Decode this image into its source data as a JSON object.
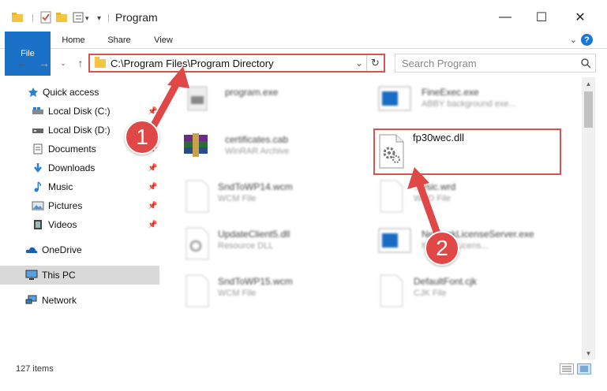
{
  "window": {
    "title": "Program",
    "minimize": "—",
    "maximize": "☐",
    "close": "✕"
  },
  "ribbon": {
    "tabs": [
      "File",
      "Home",
      "Share",
      "View"
    ],
    "help": "?"
  },
  "address": {
    "path": "C:\\Program Files\\Program Directory"
  },
  "search": {
    "placeholder": "Search Program"
  },
  "sidebar": {
    "items": [
      {
        "label": "Quick access",
        "icon": "star-icon"
      },
      {
        "label": "Local Disk (C:)",
        "icon": "drive-icon"
      },
      {
        "label": "Local Disk (D:)",
        "icon": "drive-icon"
      },
      {
        "label": "Documents",
        "icon": "documents-icon"
      },
      {
        "label": "Downloads",
        "icon": "download-icon"
      },
      {
        "label": "Music",
        "icon": "music-icon"
      },
      {
        "label": "Pictures",
        "icon": "pictures-icon"
      },
      {
        "label": "Videos",
        "icon": "videos-icon"
      },
      {
        "label": "OneDrive",
        "icon": "cloud-icon"
      },
      {
        "label": "This PC",
        "icon": "computer-icon"
      },
      {
        "label": "Network",
        "icon": "network-icon"
      }
    ]
  },
  "files": [
    {
      "name": "program.exe",
      "type": ""
    },
    {
      "name": "FineExec.exe",
      "type": "ABBY background exe..."
    },
    {
      "name": "certificates.cab",
      "type": "WinRAR Archive"
    },
    {
      "name": "fp30wec.dll",
      "type": ""
    },
    {
      "name": "SndToWP14.wcm",
      "type": "WCM File"
    },
    {
      "name": "...ysic.wrd",
      "type": "WRD File"
    },
    {
      "name": "UpdateClient5.dll",
      "type": "Resource DLL"
    },
    {
      "name": "NetworkLicenseServer.exe",
      "type": "Network Licens..."
    },
    {
      "name": "SndToWP15.wcm",
      "type": "WCM File"
    },
    {
      "name": "DefaultFont.cjk",
      "type": "CJK File"
    }
  ],
  "status": {
    "count": "127 items"
  },
  "callouts": [
    "1",
    "2"
  ],
  "colors": {
    "accent": "#1a70c6",
    "highlight": "#d9534f",
    "arrow": "#e04848"
  }
}
